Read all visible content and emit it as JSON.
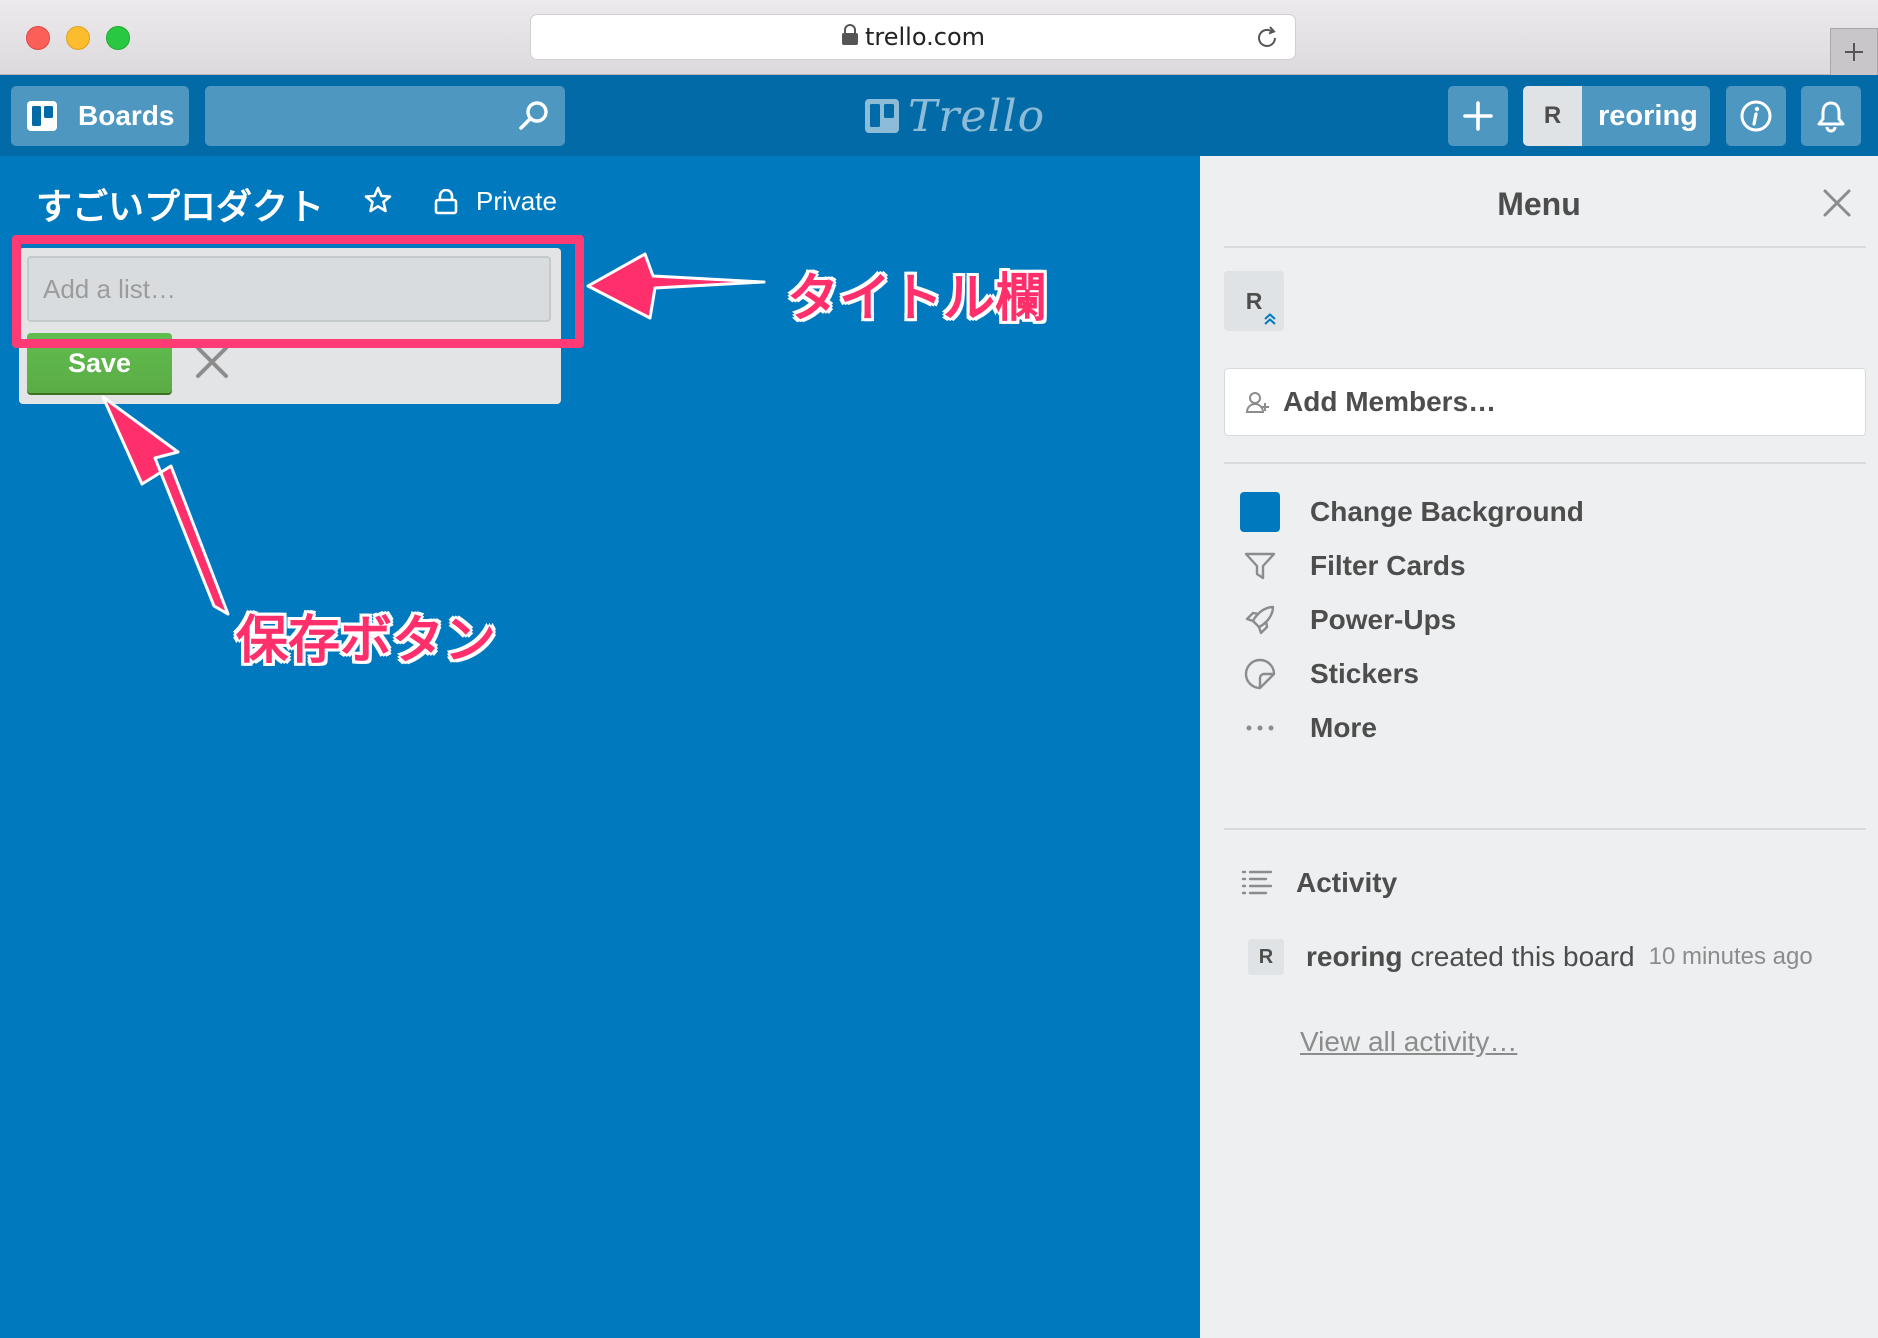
{
  "browser": {
    "url": "trello.com",
    "icons": [
      "lock-icon",
      "reload-icon",
      "new-tab-icon"
    ]
  },
  "header": {
    "boards_label": "Boards",
    "search_placeholder": "",
    "logo_text": "Trello",
    "member_initial": "R",
    "member_name": "reoring"
  },
  "board": {
    "title": "すごいプロダクト",
    "visibility": "Private",
    "background_color": "#0079bf"
  },
  "add_list": {
    "placeholder": "Add a list…",
    "value": "",
    "save_label": "Save"
  },
  "annotations": {
    "title_field": "タイトル欄",
    "save_button": "保存ボタン",
    "color": "#ff2f6c"
  },
  "menu": {
    "title": "Menu",
    "member_initial": "R",
    "add_members_label": "Add Members…",
    "items": [
      {
        "label": "Change Background",
        "icon": "background-swatch"
      },
      {
        "label": "Filter Cards",
        "icon": "filter-icon"
      },
      {
        "label": "Power-Ups",
        "icon": "rocket-icon"
      },
      {
        "label": "Stickers",
        "icon": "sticker-icon"
      },
      {
        "label": "More",
        "icon": "more-icon"
      }
    ],
    "activity": {
      "title": "Activity",
      "entries": [
        {
          "initial": "R",
          "user": "reoring",
          "text": "created this board",
          "time": "10 minutes ago"
        }
      ],
      "view_all": "View all activity…"
    }
  }
}
